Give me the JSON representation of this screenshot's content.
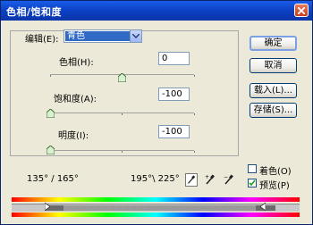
{
  "window": {
    "title": "色相/饱和度"
  },
  "edit": {
    "label": "编辑(E):",
    "selected": "青色"
  },
  "hue": {
    "label": "色相(H):",
    "value": "0"
  },
  "saturation": {
    "label": "饱和度(A):",
    "value": "-100"
  },
  "lightness": {
    "label": "明度(I):",
    "value": "-100"
  },
  "buttons": {
    "ok": "确定",
    "cancel": "取消",
    "load": "载入(L)...",
    "save": "存储(S)..."
  },
  "ranges": {
    "left": "135° / 165°",
    "right": "195°\\ 225°"
  },
  "options": {
    "colorize": "着色(O)",
    "preview": "预览(P)",
    "colorize_checked": false,
    "preview_checked": true
  },
  "sliders": {
    "hue_pos": 0.5,
    "saturation_pos": 0.0,
    "lightness_pos": 0.0
  }
}
